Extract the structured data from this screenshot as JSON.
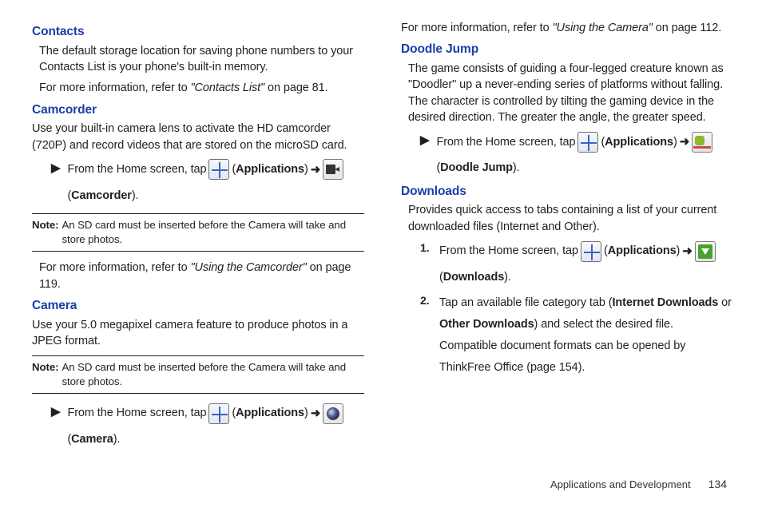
{
  "left": {
    "contacts": {
      "heading": "Contacts",
      "p1": "The default storage location for saving phone numbers to your Contacts List is your phone's built-in memory.",
      "p2_a": "For more information, refer to ",
      "p2_ref": "\"Contacts List\"",
      "p2_b": "  on page 81."
    },
    "camcorder": {
      "heading": "Camcorder",
      "p1": "Use your built-in camera lens to activate the HD camcorder (720P) and record videos that are stored on the microSD card.",
      "step_a": "From the Home screen, tap",
      "applications": "Applications",
      "arrow": "➜",
      "camcorder_label": "Camcorder",
      "note_label": "Note:",
      "note": "An SD card must be inserted before the Camera will take and store photos.",
      "p2_a": "For more information, refer to ",
      "p2_ref": "\"Using the Camcorder\"",
      "p2_b": "  on page 119."
    },
    "camera": {
      "heading": "Camera",
      "p1": "Use your 5.0 megapixel camera feature to produce photos in a JPEG format.",
      "note_label": "Note:",
      "note": "An SD card must be inserted before the Camera will take and store photos.",
      "step_a": "From the Home screen, tap",
      "applications": "Applications",
      "arrow": "➜",
      "camera_label": "Camera"
    }
  },
  "right": {
    "top_a": "For more information, refer to ",
    "top_ref": "\"Using the Camera\"",
    "top_b": "  on page 112.",
    "doodle": {
      "heading": "Doodle Jump",
      "p1": "The game consists of guiding a four-legged creature known as \"Doodler\" up a never-ending series of platforms without falling. The character is controlled by tilting the gaming device in the desired direction. The greater the angle, the greater speed.",
      "step_a": "From the Home screen, tap",
      "applications": "Applications",
      "arrow": "➜",
      "doodle_label": "Doodle Jump"
    },
    "downloads": {
      "heading": "Downloads",
      "p1": "Provides quick access to tabs containing a list of your current downloaded files (Internet and Other).",
      "s1_num": "1.",
      "s1_a": "From the Home screen, tap",
      "applications": "Applications",
      "arrow": "➜",
      "downloads_label": "Downloads",
      "s2_num": "2.",
      "s2_a": "Tap an available file category tab (",
      "s2_b1": "Internet Downloads",
      "s2_or": " or ",
      "s2_b2": "Other Downloads",
      "s2_c": ") and select the desired file. Compatible document formats can be opened by ThinkFree Office (page 154)."
    }
  },
  "footer": {
    "section": "Applications and Development",
    "page": "134"
  }
}
